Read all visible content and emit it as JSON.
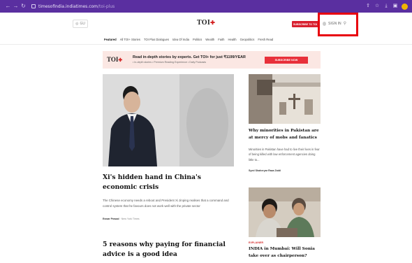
{
  "browser": {
    "url_domain": "timesofindia.indiatimes.com",
    "url_path": "/toi-plus"
  },
  "header": {
    "gu_label": "GU",
    "logo_text": "TOI",
    "subscribe_label": "SUBSCRIBE TO TOI",
    "signin_label": "SIGN IN"
  },
  "nav": {
    "items": [
      "Featured",
      "All TOI+ Stories",
      "TOI Plus Dialogues",
      "Idea Of India",
      "Politics",
      "Wealth",
      "Faith",
      "Health",
      "Geopolitics",
      "Fresh Read"
    ]
  },
  "promo": {
    "logo_text": "TOI",
    "headline": "Read in-depth stories by experts. Get TOI+ for just ₹1199/YEAR",
    "sub": "•  In-depth stories     •  Premium Reading Experience     •  Daily Podcasts",
    "button_label": "SUBSCRIBE NOW"
  },
  "main_story": {
    "title": "Xi's hidden hand in China's economic crisis",
    "description": "The Chinese economy needs a reboot and President Xi Jinping realises that a command and control system that he favours does not work well with the private sector",
    "author": "Eswar Prasad",
    "source": "New York Times"
  },
  "second_story": {
    "title": "5 reasons why paying for financial advice is a good idea"
  },
  "side_story_1": {
    "title": "Why minorities in Pakistan are at mercy of mobs and fanatics",
    "description": "Minorities in Pakistan have had to live their lives in fear of being killed with law enforcement agencies doing little to...",
    "byline": "Syed Shaheryar Raza Zaidi"
  },
  "side_story_2": {
    "tag": "EXPLAINER",
    "title": "INDIA in Mumbai: Will Sonia take over as chairperson?"
  }
}
